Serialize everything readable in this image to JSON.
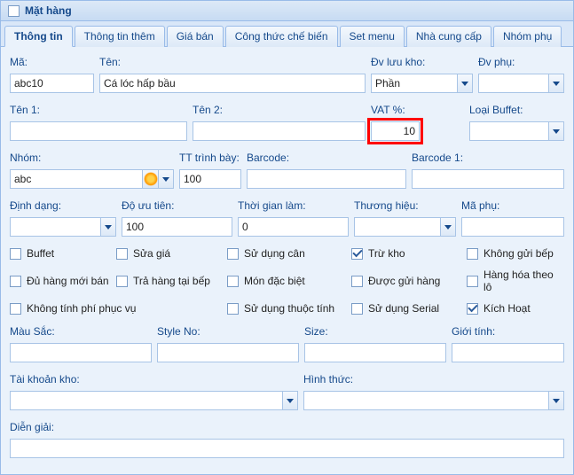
{
  "header": {
    "title": "Mặt hàng"
  },
  "tabs": [
    {
      "label": "Thông tin",
      "active": true
    },
    {
      "label": "Thông tin thêm"
    },
    {
      "label": "Giá bán"
    },
    {
      "label": "Công thức chế biến"
    },
    {
      "label": "Set menu"
    },
    {
      "label": "Nhà cung cấp"
    },
    {
      "label": "Nhóm phụ"
    }
  ],
  "row1": {
    "ma_label": "Mã:",
    "ma_value": "abc10",
    "ten_label": "Tên:",
    "ten_value": "Cá lóc hấp bầu",
    "dvluu_label": "Đv lưu kho:",
    "dvluu_value": "Phần",
    "dvphu_label": "Đv phụ:",
    "dvphu_value": ""
  },
  "row2": {
    "ten1_label": "Tên 1:",
    "ten1_value": "",
    "ten2_label": "Tên 2:",
    "ten2_value": "",
    "vat_label": "VAT %:",
    "vat_value": "10",
    "buffet_label": "Loại Buffet:",
    "buffet_value": ""
  },
  "row3": {
    "nhom_label": "Nhóm:",
    "nhom_value": "abc",
    "tttb_label": "TT trình bày:",
    "tttb_value": "100",
    "barcode_label": "Barcode:",
    "barcode_value": "",
    "barcode1_label": "Barcode 1:",
    "barcode1_value": ""
  },
  "row4": {
    "dd_label": "Định dạng:",
    "dd_value": "",
    "douu_label": "Độ ưu tiên:",
    "douu_value": "100",
    "tgl_label": "Thời gian làm:",
    "tgl_value": "0",
    "th_label": "Thương hiệu:",
    "th_value": "",
    "maphu_label": "Mã phụ:",
    "maphu_value": ""
  },
  "checks": {
    "c1": "Buffet",
    "c2": "Sửa giá",
    "c3": "Sử dụng cân",
    "c4": "Trừ kho",
    "c5": "Không gửi bếp",
    "c6": "Đủ hàng mới bán",
    "c7": "Trả hàng tại bếp",
    "c8": "Món đặc biệt",
    "c9": "Được gửi hàng",
    "c10": "Hàng hóa theo lô",
    "c11": "Không tính phí phục vụ",
    "c12": "Sử dụng thuộc tính",
    "c13": "Sử dụng Serial",
    "c14": "Kích Hoạt"
  },
  "row5": {
    "mau_label": "Màu Sắc:",
    "mau_value": "",
    "style_label": "Style No:",
    "style_value": "",
    "size_label": "Size:",
    "size_value": "",
    "gioi_label": "Giới tính:",
    "gioi_value": ""
  },
  "row6": {
    "tk_label": "Tài khoản kho:",
    "tk_value": "",
    "ht_label": "Hình thức:",
    "ht_value": ""
  },
  "row7": {
    "dg_label": "Diễn giải:",
    "dg_value": ""
  }
}
